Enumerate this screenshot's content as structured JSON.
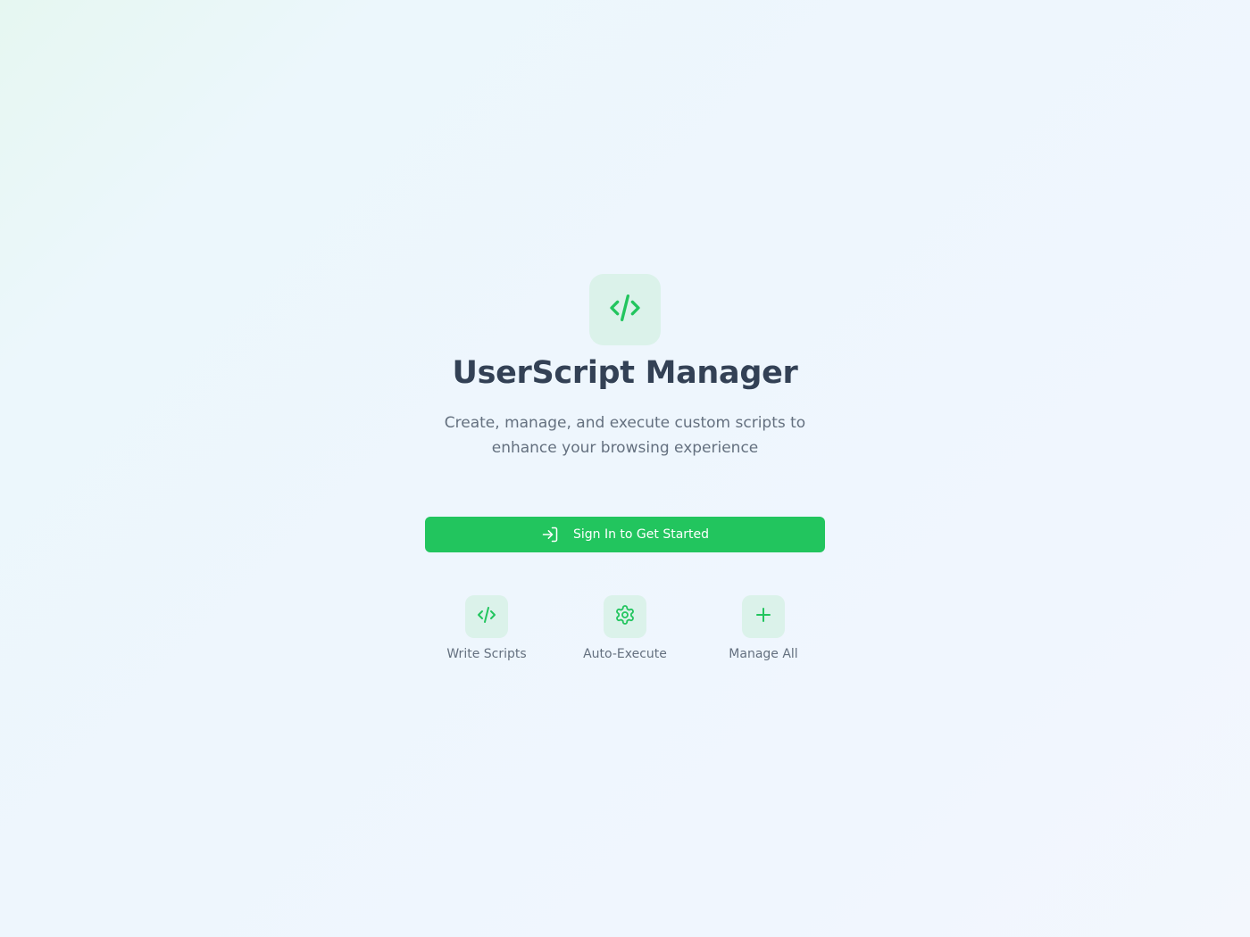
{
  "app": {
    "title": "UserScript Manager",
    "subtitle_line1": "Create, manage, and execute custom scripts to",
    "subtitle_line2": "enhance your browsing experience",
    "logo_icon": "code-icon"
  },
  "cta": {
    "label": "Sign In to Get Started",
    "icon": "sign-in-icon"
  },
  "features": [
    {
      "label": "Write Scripts",
      "icon": "code-icon"
    },
    {
      "label": "Auto-Execute",
      "icon": "gear-icon"
    },
    {
      "label": "Manage All",
      "icon": "plus-icon"
    }
  ],
  "colors": {
    "accent": "#22c55e",
    "icon_bg": "#dbf2ea",
    "title": "#334155",
    "muted_text": "#64707f"
  }
}
